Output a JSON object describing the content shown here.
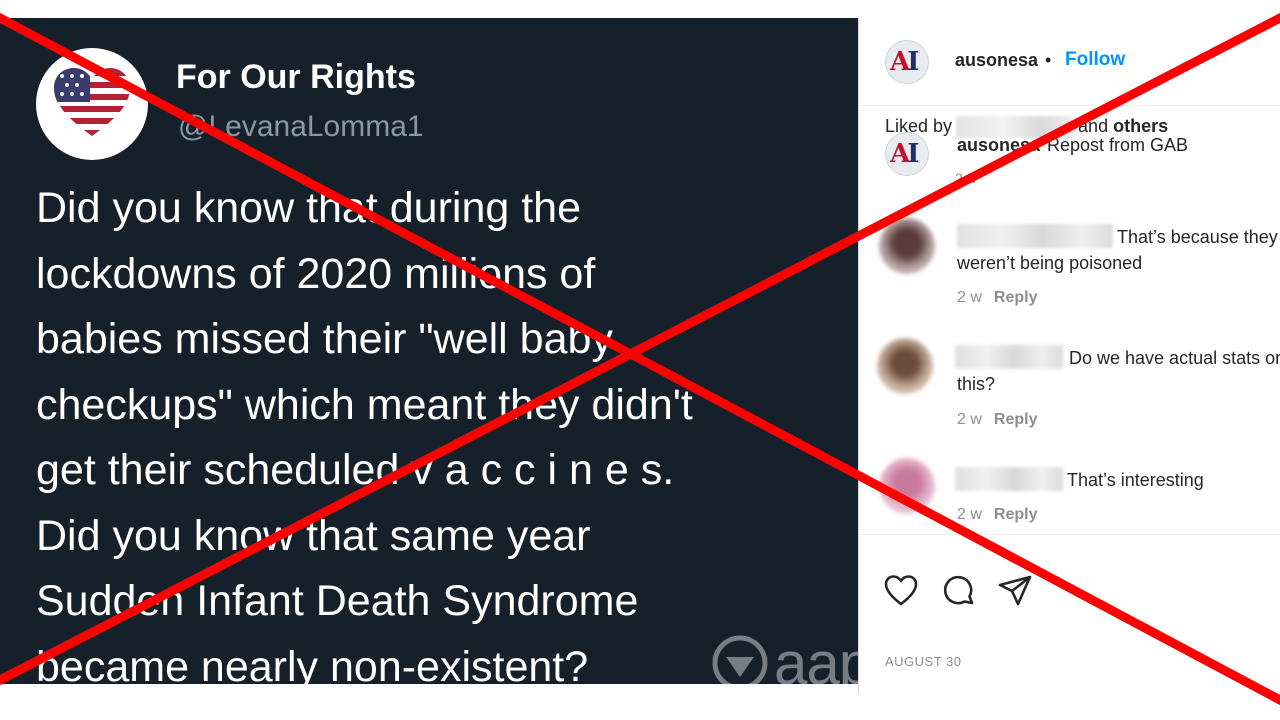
{
  "tweet": {
    "display_name": "For Our Rights",
    "handle": "@LevanaLomma1",
    "body": "Did you know that during the\nlockdowns of 2020 millions of\nbabies missed their \"well baby\ncheckups\" which meant they didn't\nget their scheduled v a c c i n e s.\nDid you know that same year\nSudden Infant Death Syndrome\nbecame nearly non-existent?",
    "avatar_icon": "flag-heart-icon"
  },
  "watermark": {
    "text": "aap",
    "logo_icon": "aap-logo-icon"
  },
  "instagram": {
    "header": {
      "username": "ausonesa",
      "dot": "•",
      "follow_label": "Follow"
    },
    "caption": {
      "username": "ausonesa",
      "text": "Repost from GAB",
      "time": "2 w"
    },
    "comments": [
      {
        "text": "That’s because they weren’t being poisoned",
        "time": "2 w",
        "reply": "Reply"
      },
      {
        "text": "Do we have actual stats on this?",
        "time": "2 w",
        "reply": "Reply"
      },
      {
        "text": "That’s interesting",
        "time": "2 w",
        "reply": "Reply"
      }
    ],
    "actions": {
      "like_icon": "heart-icon",
      "comment_icon": "comment-icon",
      "share_icon": "share-icon"
    },
    "liked_by": {
      "prefix": "Liked by",
      "middle": "and",
      "suffix": "others"
    },
    "date": "AUGUST 30"
  },
  "colors": {
    "cross": "#ff0000",
    "tweet_bg": "#15202b",
    "follow": "#0095f6"
  }
}
